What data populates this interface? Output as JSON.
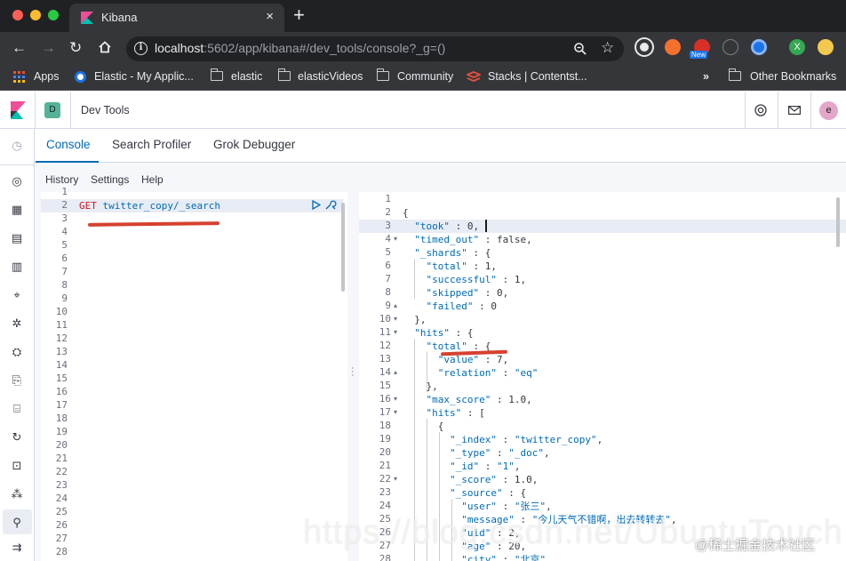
{
  "browser": {
    "tab_title": "Kibana",
    "tab_close": "×",
    "new_tab": "+",
    "url_host": "localhost",
    "url_rest": ":5602/app/kibana#/dev_tools/console?_g=()",
    "new_badge": "New",
    "profile_letter": "X",
    "bookmarks": [
      "Apps",
      "Elastic - My Applic...",
      "elastic",
      "elasticVideos",
      "Community",
      "Stacks | Contentst...",
      "»",
      "Other Bookmarks"
    ]
  },
  "kibana": {
    "space_initial": "D",
    "breadcrumb": "Dev Tools",
    "user_initial": "e",
    "tabs": [
      "Console",
      "Search Profiler",
      "Grok Debugger"
    ],
    "menu": [
      "History",
      "Settings",
      "Help"
    ]
  },
  "request": {
    "method": "GET",
    "path": "twitter_copy/_search"
  },
  "response": {
    "line1": "{",
    "line2a": "\"took\"",
    "line2b": " : 0,",
    "line3a": "\"timed_out\"",
    "line3b": " : false,",
    "line4a": "\"_shards\"",
    "line4b": " : {",
    "line5a": "\"total\"",
    "line5b": " : 1,",
    "line6a": "\"successful\"",
    "line6b": " : 1,",
    "line7a": "\"skipped\"",
    "line7b": " : 0,",
    "line8a": "\"failed\"",
    "line8b": " : 0",
    "line9": "},",
    "line10a": "\"hits\"",
    "line10b": " : {",
    "line11a": "\"total\"",
    "line11b": " : {",
    "line12a": "\"value\"",
    "line12b": " : 7,",
    "line13a": "\"relation\"",
    "line13b": " : ",
    "line13c": "\"eq\"",
    "line14": "},",
    "line15a": "\"max_score\"",
    "line15b": " : 1.0,",
    "line16a": "\"hits\"",
    "line16b": " : [",
    "line17": "{",
    "line18a": "\"_index\"",
    "line18b": " : ",
    "line18c": "\"twitter_copy\"",
    "line18d": ",",
    "line19a": "\"_type\"",
    "line19b": " : ",
    "line19c": "\"_doc\"",
    "line19d": ",",
    "line20a": "\"_id\"",
    "line20b": " : ",
    "line20c": "\"1\"",
    "line20d": ",",
    "line21a": "\"_score\"",
    "line21b": " : 1.0,",
    "line22a": "\"_source\"",
    "line22b": " : {",
    "line23a": "\"user\"",
    "line23b": " : ",
    "line23c": "\"张三\"",
    "line23d": ",",
    "line24a": "\"message\"",
    "line24b": " : ",
    "line24c": "\"今儿天气不错啊，出去转转去\"",
    "line24d": ",",
    "line25a": "\"uid\"",
    "line25b": " : 2,",
    "line26a": "\"age\"",
    "line26b": " : 20,",
    "line27a": "\"city\"",
    "line27b": " : ",
    "line27c": "\"北京\"",
    "line27d": ","
  },
  "watermark": "https://blog.csdn.net/UbuntuTouch",
  "corner_watermark": "@稀土掘金技术社区",
  "colors": {
    "accent": "#006bb4",
    "get": "#c61e25",
    "annotation": "#d6412f"
  }
}
